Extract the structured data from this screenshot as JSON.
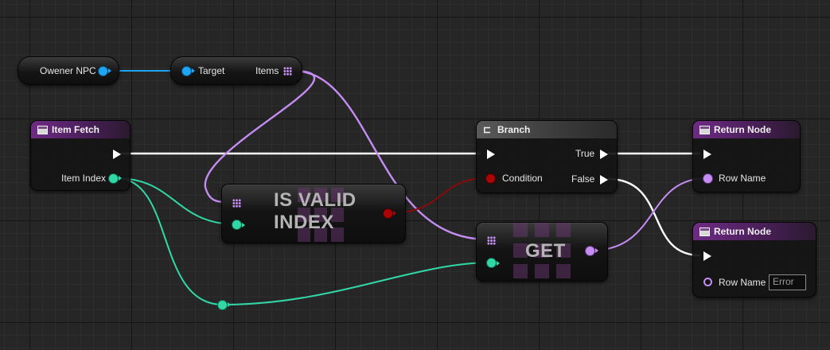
{
  "graph": {
    "owener_npc": {
      "label": "Owener NPC"
    },
    "get_items": {
      "target_label": "Target",
      "items_label": "Items"
    },
    "item_fetch": {
      "title": "Item Fetch",
      "item_index_label": "Item Index"
    },
    "is_valid_index": {
      "title_line1": "IS VALID",
      "title_line2": "INDEX"
    },
    "branch": {
      "title": "Branch",
      "condition_label": "Condition",
      "true_label": "True",
      "false_label": "False"
    },
    "get": {
      "title": "GET"
    },
    "return_node_1": {
      "title": "Return Node",
      "row_name_label": "Row Name"
    },
    "return_node_2": {
      "title": "Return Node",
      "row_name_label": "Row Name",
      "row_name_value": "Error"
    }
  },
  "colors": {
    "exec": "#ffffff",
    "object_pin": "#1ea5f5",
    "integer_pin": "#31d8a6",
    "boolean_pin": "#a80606",
    "name_pin": "#c58cf2",
    "function_header": "#6f2b84"
  },
  "icons": {
    "function": "function-icon",
    "branch": "branch-icon",
    "array": "array-grid-icon"
  }
}
